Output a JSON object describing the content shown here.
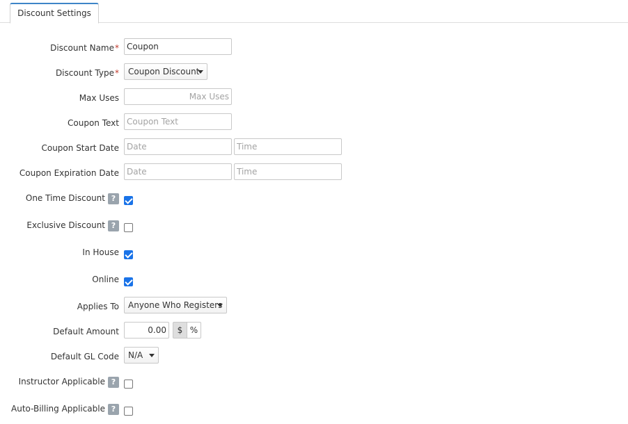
{
  "tabs": [
    {
      "label": "Discount Settings"
    }
  ],
  "form": {
    "discount_name": {
      "label": "Discount Name",
      "required_mark": "*",
      "value": "Coupon"
    },
    "discount_type": {
      "label": "Discount Type",
      "required_mark": "*",
      "selected": "Coupon Discount"
    },
    "max_uses": {
      "label": "Max Uses",
      "value": "",
      "placeholder": "Max Uses"
    },
    "coupon_text": {
      "label": "Coupon Text",
      "value": "",
      "placeholder": "Coupon Text"
    },
    "coupon_start_date": {
      "label": "Coupon Start Date",
      "date_placeholder": "Date",
      "time_placeholder": "Time"
    },
    "coupon_expiration_date": {
      "label": "Coupon Expiration Date",
      "date_placeholder": "Date",
      "time_placeholder": "Time"
    },
    "one_time_discount": {
      "label": "One Time Discount",
      "help": "?",
      "checked": true
    },
    "exclusive_discount": {
      "label": "Exclusive Discount",
      "help": "?",
      "checked": false
    },
    "in_house": {
      "label": "In House",
      "checked": true
    },
    "online": {
      "label": "Online",
      "checked": true
    },
    "applies_to": {
      "label": "Applies To",
      "selected": "Anyone Who Registers"
    },
    "default_amount": {
      "label": "Default Amount",
      "value": "0.00",
      "units": [
        "$",
        "%"
      ],
      "active_unit": "$"
    },
    "default_gl_code": {
      "label": "Default GL Code",
      "selected": "N/A"
    },
    "instructor_applicable": {
      "label": "Instructor Applicable",
      "help": "?",
      "checked": false
    },
    "auto_billing_applicable": {
      "label": "Auto-Billing Applicable",
      "help": "?",
      "checked": false
    }
  },
  "colors": {
    "tab_accent": "#3e85c7",
    "checkbox_on": "#1a73e8",
    "required": "#c0392b",
    "help_badge": "#9aa4ad"
  }
}
